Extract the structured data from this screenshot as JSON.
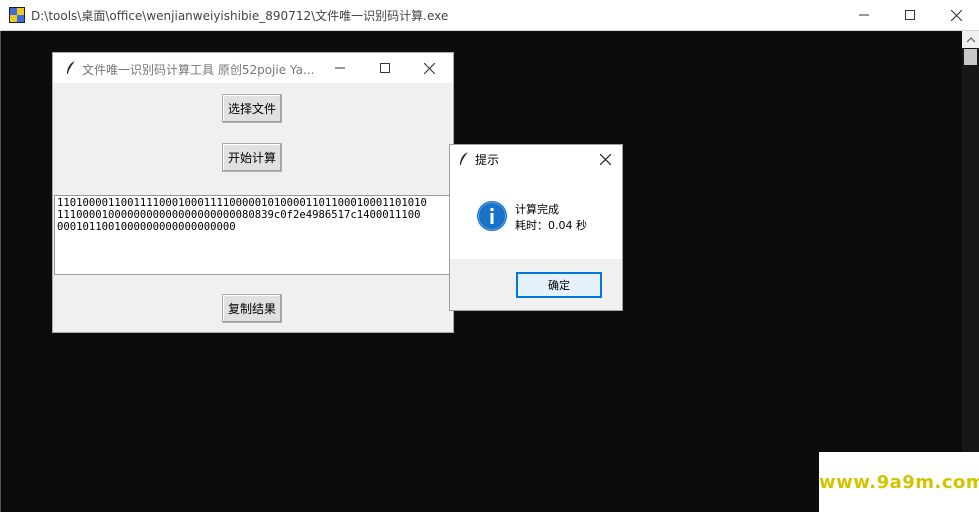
{
  "console": {
    "title": "D:\\tools\\桌面\\office\\wenjianweiyishibie_890712\\文件唯一识别码计算.exe"
  },
  "app": {
    "title": "文件唯一识别码计算工具 原创52pojie Ya...",
    "select_file_label": "选择文件",
    "start_calc_label": "开始计算",
    "copy_result_label": "复制结果",
    "result_lines": [
      "1101000011001111000100011110000010100001101100010001101010",
      "1110000100000000000000000000080839c0f2e4986517c1400011100",
      "0001011001000000000000000000"
    ]
  },
  "dialog": {
    "title": "提示",
    "message_line1": "计算完成",
    "message_line2": "耗时：0.04 秒",
    "ok_label": "确定",
    "icon": "info-icon"
  },
  "watermark": {
    "text": "www.9a9m.com"
  },
  "colors": {
    "console_bg": "#0c0c0c",
    "accent": "#0078d7",
    "info_icon": "#1a72c9",
    "watermark": "#d4c400"
  }
}
